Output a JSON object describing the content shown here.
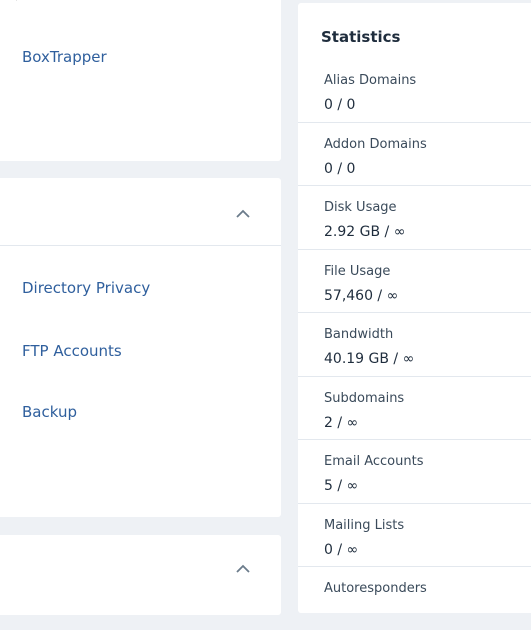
{
  "left_panels": {
    "email_tools": {
      "items": [
        {
          "label": "BoxTrapper",
          "icon": "boxtrapper-icon"
        }
      ]
    },
    "files": {
      "items": [
        {
          "label": "Directory Privacy",
          "icon": "directory-privacy-icon"
        },
        {
          "label": "FTP Accounts",
          "icon": "ftp-accounts-icon"
        },
        {
          "label": "Backup",
          "icon": "backup-icon"
        }
      ]
    }
  },
  "statistics": {
    "title": "Statistics",
    "rows": [
      {
        "label": "Alias Domains",
        "value": "0 / 0"
      },
      {
        "label": "Addon Domains",
        "value": "0 / 0"
      },
      {
        "label": "Disk Usage",
        "value": "2.92 GB / ∞"
      },
      {
        "label": "File Usage",
        "value": "57,460 / ∞"
      },
      {
        "label": "Bandwidth",
        "value": "40.19 GB / ∞"
      },
      {
        "label": "Subdomains",
        "value": "2 / ∞"
      },
      {
        "label": "Email Accounts",
        "value": "5 / ∞"
      },
      {
        "label": "Mailing Lists",
        "value": "0 / ∞"
      },
      {
        "label": "Autoresponders",
        "value": ""
      }
    ]
  },
  "colors": {
    "link": "#2f5f9d",
    "accent_orange": "#e86e2c",
    "background": "#eef1f5"
  }
}
